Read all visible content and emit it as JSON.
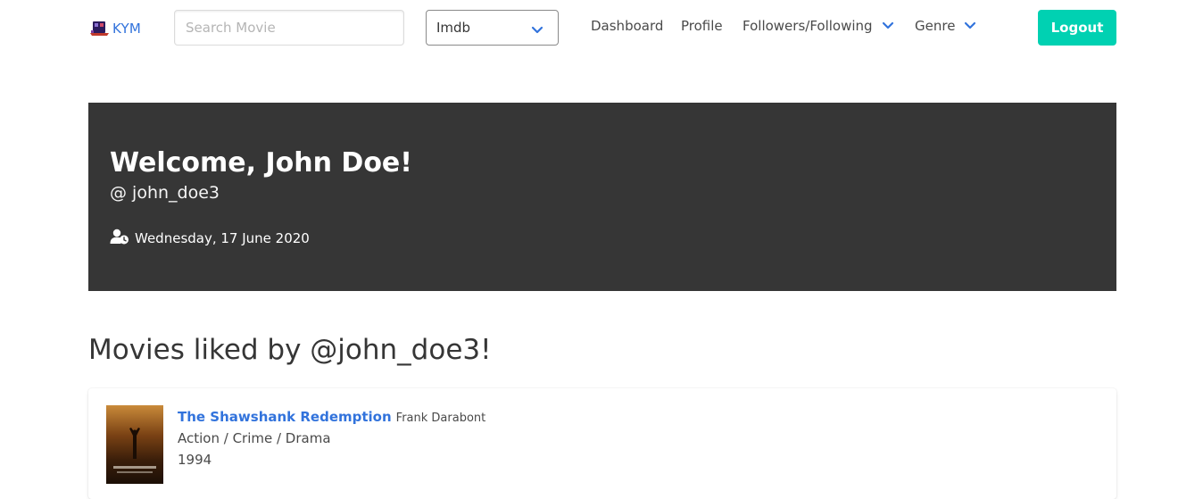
{
  "navbar": {
    "brand_text": "KYM",
    "search_placeholder": "Search Movie",
    "search_value": "",
    "source_select": "Imdb",
    "links": {
      "dashboard": "Dashboard",
      "profile": "Profile",
      "followers": "Followers/Following",
      "genre": "Genre"
    },
    "logout_label": "Logout"
  },
  "hero": {
    "title": "Welcome, John Doe!",
    "subtitle": "@ john_doe3",
    "date": "Wednesday, 17 June 2020",
    "date_icon": "user-clock-icon"
  },
  "section": {
    "title": "Movies liked by @john_doe3!"
  },
  "movies": [
    {
      "title": "The Shawshank Redemption",
      "director": "Frank Darabont",
      "genres": "Action / Crime / Drama",
      "year": "1994"
    }
  ],
  "colors": {
    "primary": "#00d1b2",
    "link": "#3273dc",
    "hero_bg": "#363636",
    "text": "#4a4a4a"
  }
}
